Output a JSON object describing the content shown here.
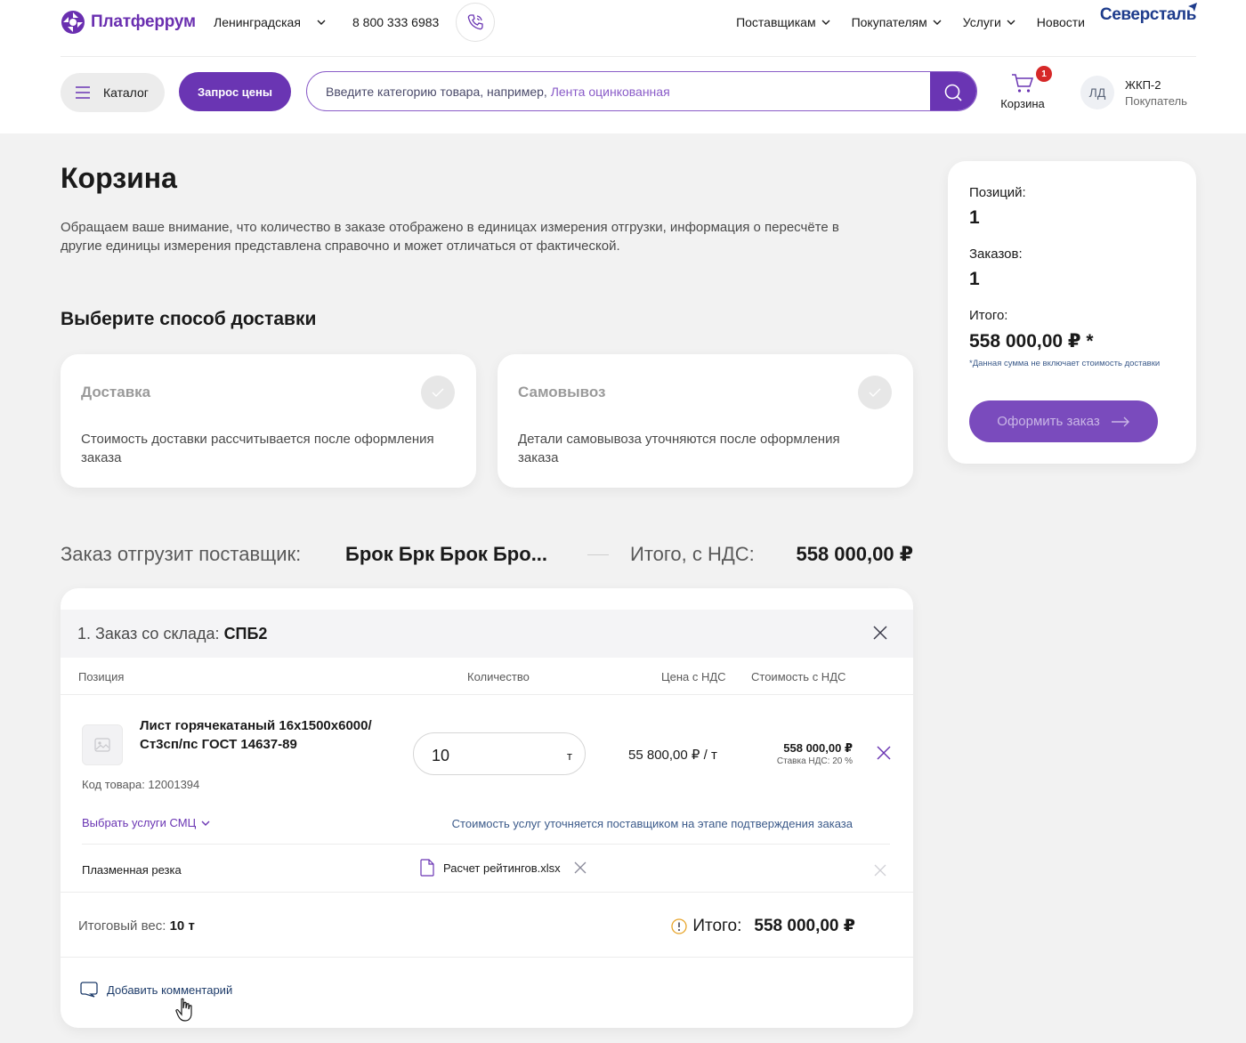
{
  "header": {
    "logo_text": "Платферрум",
    "city": "Ленинградская",
    "phone": "8 800 333 6983",
    "nav": [
      "Поставщикам",
      "Покупателям",
      "Услуги",
      "Новости"
    ],
    "brand": "Северсталь",
    "catalog_label": "Каталог",
    "request_price_label": "Запрос цены",
    "search": {
      "placeholder": "Введите категорию товара, например, ",
      "placeholder_example": "Лента оцинкованная"
    },
    "cart": {
      "label": "Корзина",
      "count": "1"
    },
    "user": {
      "initials": "ЛД",
      "name": "ЖКП-2",
      "role": "Покупатель"
    }
  },
  "main": {
    "title": "Корзина",
    "notice": "Обращаем ваше внимание, что количество в заказе отображено в единицах измерения отгрузки, информация о пересчёте в другие единицы измерения представлена справочно и может отличаться от фактической.",
    "delivery_section_title": "Выберите способ доставки",
    "delivery_options": [
      {
        "title": "Доставка",
        "description": "Стоимость доставки рассчитывается после оформления заказа"
      },
      {
        "title": "Самовывоз",
        "description": "Детали самовывоза уточняются после оформления заказа"
      }
    ],
    "supplier_label": "Заказ отгрузит поставщик:",
    "supplier_name": "Брок Брк Брок Бро...",
    "total_vat_label": "Итого, с НДС:",
    "total_vat_value": "558 000,00 ₽"
  },
  "order": {
    "title_prefix": "1. Заказ со склада: ",
    "warehouse": "СПБ2",
    "columns": [
      "Позиция",
      "Количество",
      "Цена с НДС",
      "Стоимость с НДС"
    ],
    "item": {
      "name": "Лист горячекатаный 16х1500х6000/Ст3сп/пс ГОСТ 14637-89",
      "code": "Код товара: 12001394",
      "quantity": "10",
      "unit": "т",
      "price": "55 800,00 ₽ / т",
      "cost": "558 000,00 ₽",
      "vat_rate": "Ставка НДС: 20 %"
    },
    "smc_link": "Выбрать услуги СМЦ",
    "smc_note": "Стоимость услуг уточняется поставщиком на этапе подтверждения заказа",
    "service": {
      "name": "Плазменная резка",
      "file": "Расчет рейтингов.xlsx"
    },
    "weight_label": "Итоговый вес: ",
    "weight_value": "10 т",
    "total_label": "Итого:",
    "total_value": "558 000,00 ₽",
    "comment_label": "Добавить комментарий"
  },
  "summary": {
    "positions_label": "Позиций:",
    "positions_value": "1",
    "orders_label": "Заказов:",
    "orders_value": "1",
    "total_label": "Итого:",
    "total_value": "558 000,00 ₽ *",
    "note": "*Данная сумма не включает стоимость доставки",
    "checkout_label": "Оформить заказ"
  },
  "colors": {
    "accent": "#6a35b3",
    "brand_blue": "#1e3c8c",
    "badge": "#d62828"
  },
  "icons": [
    "logo-icon",
    "chevron-down-icon",
    "phone-icon",
    "menu-icon",
    "search-icon",
    "cart-icon",
    "check-icon",
    "close-icon",
    "image-placeholder-icon",
    "file-icon",
    "info-icon",
    "comment-icon",
    "arrow-right-icon",
    "pointer-cursor-icon"
  ]
}
